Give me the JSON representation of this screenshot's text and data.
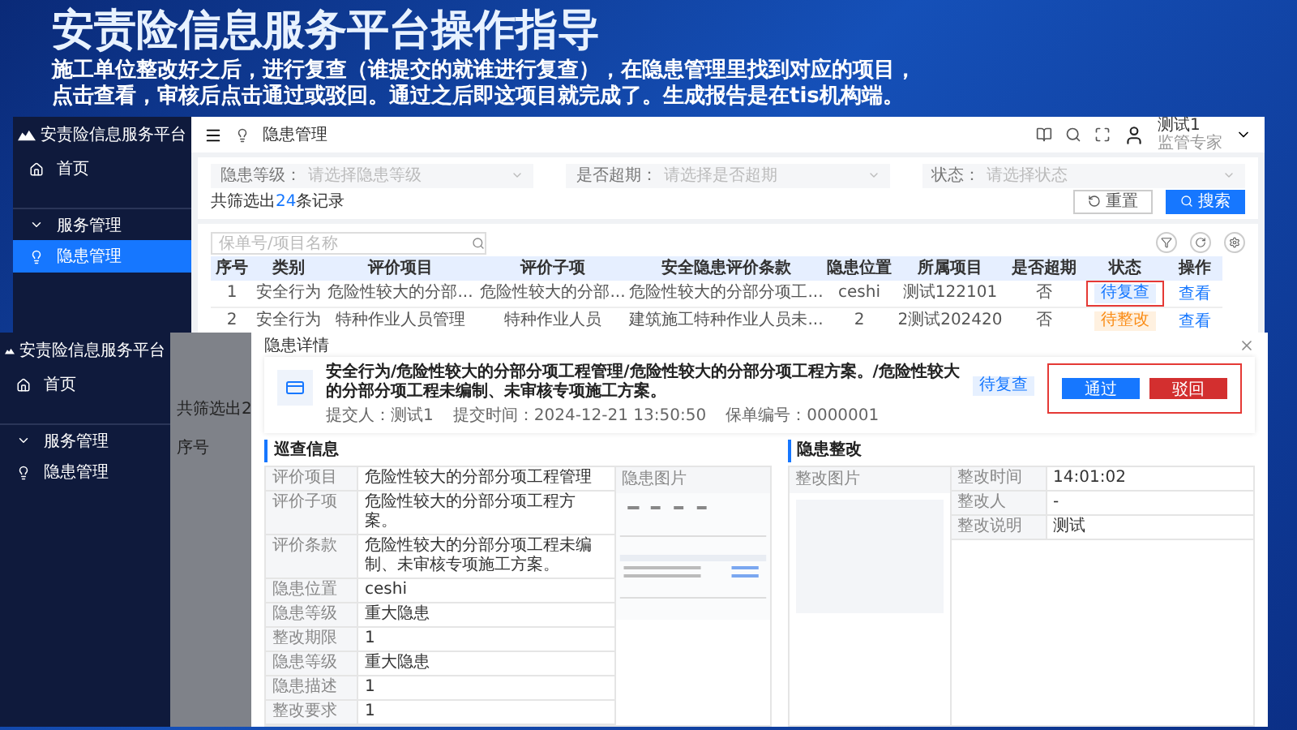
{
  "slide": {
    "title": "安责险信息服务平台操作指导",
    "description": "施工单位整改好之后，进行复查（谁提交的就谁进行复查），在隐患管理里找到对应的项目，点击查看，审核后点击通过或驳回。通过之后即这项目就完成了。生成报告是在tis机构端。"
  },
  "back_screen": {
    "sidebar": {
      "brand": "安责险信息服务平台",
      "items": [
        {
          "label": "首页",
          "selected": false
        },
        {
          "label": "服务管理",
          "selected": false
        },
        {
          "label": "隐患管理",
          "selected": true
        }
      ]
    },
    "header": {
      "breadcrumb": "隐患管理",
      "user": {
        "name": "测试1",
        "role": "监管专家"
      }
    },
    "filters": [
      {
        "label": "隐患等级：",
        "placeholder": "请选择隐患等级"
      },
      {
        "label": "是否超期：",
        "placeholder": "请选择是否超期"
      },
      {
        "label": "状态：",
        "placeholder": "请选择状态"
      }
    ],
    "result_count": {
      "prefix": "共筛选出",
      "count": "24",
      "suffix": "条记录"
    },
    "buttons": [
      {
        "label": "重置",
        "kind": "reset"
      },
      {
        "label": "搜索",
        "kind": "search"
      }
    ],
    "search": {
      "placeholder": "保单号/项目名称"
    },
    "table": {
      "columns": [
        "序号",
        "类别",
        "评价项目",
        "评价子项",
        "安全隐患评价条款",
        "隐患位置",
        "所属项目",
        "是否超期",
        "状态",
        "操作"
      ],
      "rows": [
        {
          "cells": [
            "1",
            "安全行为",
            "危险性较大的分部...",
            "危险性较大的分部...",
            "危险性较大的分部分项工...",
            "ceshi",
            "测试122101",
            "否"
          ],
          "status": {
            "label": "待复查",
            "kind": "review",
            "highlighted": true
          },
          "action": "查看"
        },
        {
          "cells": [
            "2",
            "安全行为",
            "特种作业人员管理",
            "特种作业人员",
            "建筑施工特种作业人员未...",
            "2",
            "2测试202420",
            "否"
          ],
          "status": {
            "label": "待整改",
            "kind": "rectify",
            "highlighted": false
          },
          "action": "查看"
        }
      ]
    }
  },
  "front_screen": {
    "sidebar": {
      "brand": "安责险信息服务平台",
      "items": [
        {
          "label": "首页",
          "selected": false
        },
        {
          "label": "服务管理",
          "selected": false
        },
        {
          "label": "隐患管理",
          "selected": false
        }
      ]
    },
    "backdrop": {
      "result_count_fragment": "共筛选出2",
      "column_fragment": "序号"
    },
    "modal": {
      "title": "隐患详情",
      "record": {
        "title": "安全行为/危险性较大的分部分项工程管理/危险性较大的分部分项工程方案。/危险性较大的分部分项工程未编制、未审核专项施工方案。",
        "status": {
          "label": "待复查",
          "kind": "review"
        },
        "meta": [
          "提交人：测试1",
          "提交时间：2024-12-21 13:50:50",
          "保单编号：0000001"
        ]
      },
      "actions": [
        {
          "label": "通过",
          "kind": "approve"
        },
        {
          "label": "驳回",
          "kind": "reject"
        }
      ],
      "actions_highlighted": true,
      "inspection": {
        "title": "巡查信息",
        "picture_label": "隐患图片",
        "rows": [
          {
            "label": "评价项目",
            "value": "危险性较大的分部分项工程管理"
          },
          {
            "label": "评价子项",
            "value": "危险性较大的分部分项工程方案。"
          },
          {
            "label": "评价条款",
            "value": "危险性较大的分部分项工程未编制、未审核专项施工方案。"
          },
          {
            "label": "隐患位置",
            "value": "ceshi"
          },
          {
            "label": "隐患等级",
            "value": "重大隐患"
          },
          {
            "label": "整改期限",
            "value": "1"
          },
          {
            "label": "隐患等级",
            "value": "重大隐患"
          },
          {
            "label": "隐患描述",
            "value": "1"
          },
          {
            "label": "整改要求",
            "value": "1"
          }
        ]
      },
      "rectification": {
        "title": "隐患整改",
        "picture_label": "整改图片",
        "rows": [
          {
            "label": "整改时间",
            "value": "14:01:02"
          },
          {
            "label": "整改人",
            "value": "-"
          },
          {
            "label": "整改说明",
            "value": "测试"
          }
        ]
      }
    }
  }
}
